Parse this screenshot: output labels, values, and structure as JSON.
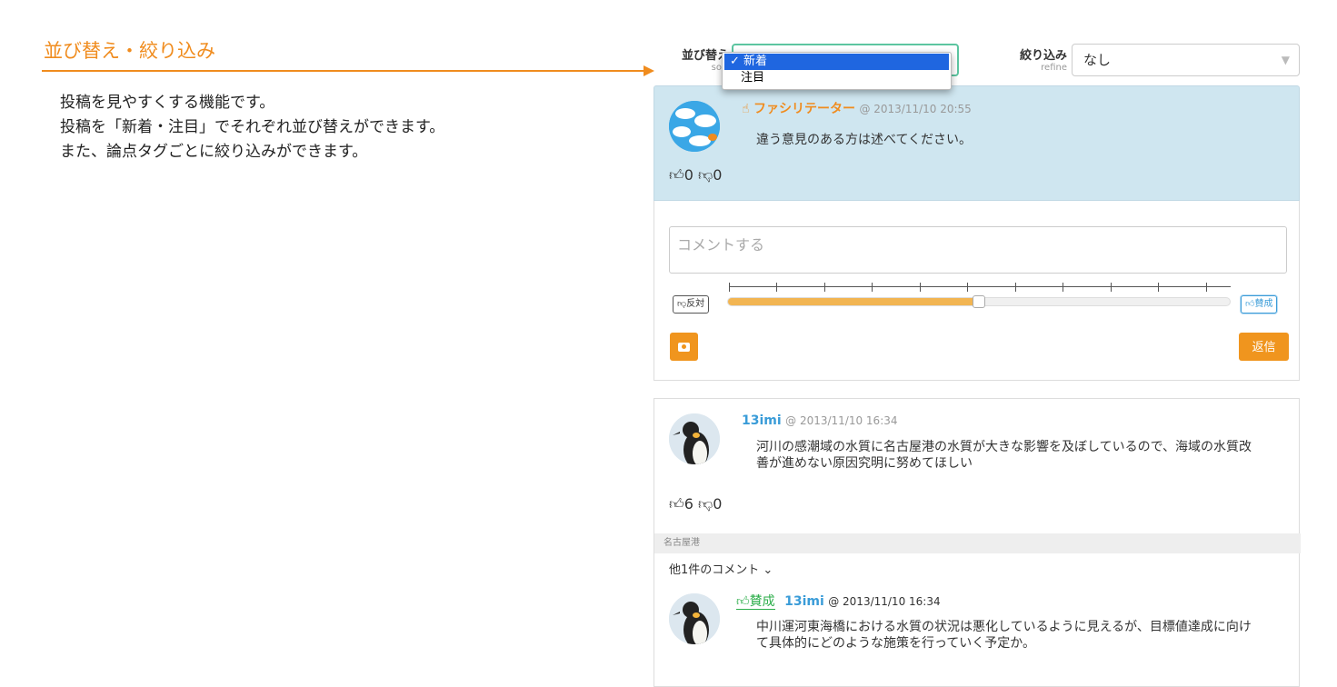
{
  "annotation": {
    "title": "並び替え・絞り込み",
    "lines": [
      "投稿を見やすくする機能です。",
      "投稿を「新着・注目」でそれぞれ並び替えができます。",
      "また、論点タグごとに絞り込みができます。"
    ],
    "accent_color": "#f08c1e"
  },
  "toolbar": {
    "sort_label": "並び替え",
    "sort_sublabel": "sort",
    "sort_options": [
      "新着",
      "注目"
    ],
    "sort_selected": "新着",
    "refine_label": "絞り込み",
    "refine_sublabel": "refine",
    "refine_value": "なし"
  },
  "facilitator_post": {
    "icon": "thumbs-up-icon",
    "author": "ファシリテーター",
    "timestamp": "@ 2013/11/10 20:55",
    "text": "違う意見のある方は述べてください。",
    "likes": "0",
    "dislikes": "0"
  },
  "comment_form": {
    "placeholder": "コメントする",
    "oppose_label": "反対",
    "agree_label": "賛成",
    "stance_value": 0.5,
    "reply_label": "返信",
    "camera_icon": "camera-icon"
  },
  "post": {
    "author": "13imi",
    "timestamp": "@ 2013/11/10 16:34",
    "text_line1": "河川の感潮域の水質に名古屋港の水質が大きな影響を及ぼしているので、海域の水質改",
    "text_line2": "善が進めない原因究明に努めてほしい",
    "likes": "6",
    "dislikes": "0",
    "tag": "名古屋港",
    "more_comments": "他1件のコメント"
  },
  "reply": {
    "stance": "賛成",
    "author": "13imi",
    "timestamp": "@ 2013/11/10 16:34",
    "text_line1": "中川運河東海橋における水質の状況は悪化しているように見えるが、目標値達成に向け",
    "text_line2": "て具体的にどのような施策を行っていく予定か。"
  }
}
